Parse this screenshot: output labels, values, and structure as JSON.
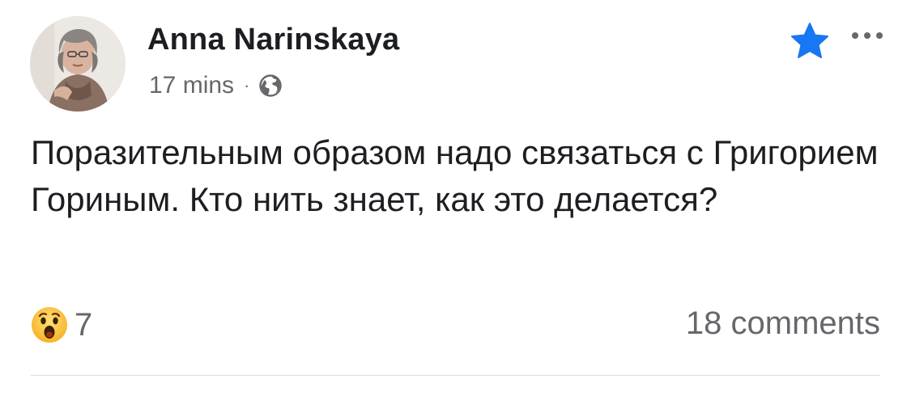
{
  "post": {
    "author": "Anna Narinskaya",
    "time": "17 mins",
    "separator": "·",
    "audience_icon": "globe-icon",
    "text": "Поразительным образом надо связаться с Григорием Гориным. Кто нить знает, как это делается?",
    "favorite_icon": "star-icon",
    "favorite_color": "#1877f2",
    "more_icon": "more-horizontal-icon"
  },
  "footer": {
    "reaction_icon": "wow-reaction-icon",
    "reaction_count": "7",
    "comments": "18 comments"
  },
  "colors": {
    "text_primary": "#1c1e21",
    "text_secondary": "#65676b",
    "divider": "#dadde1"
  }
}
